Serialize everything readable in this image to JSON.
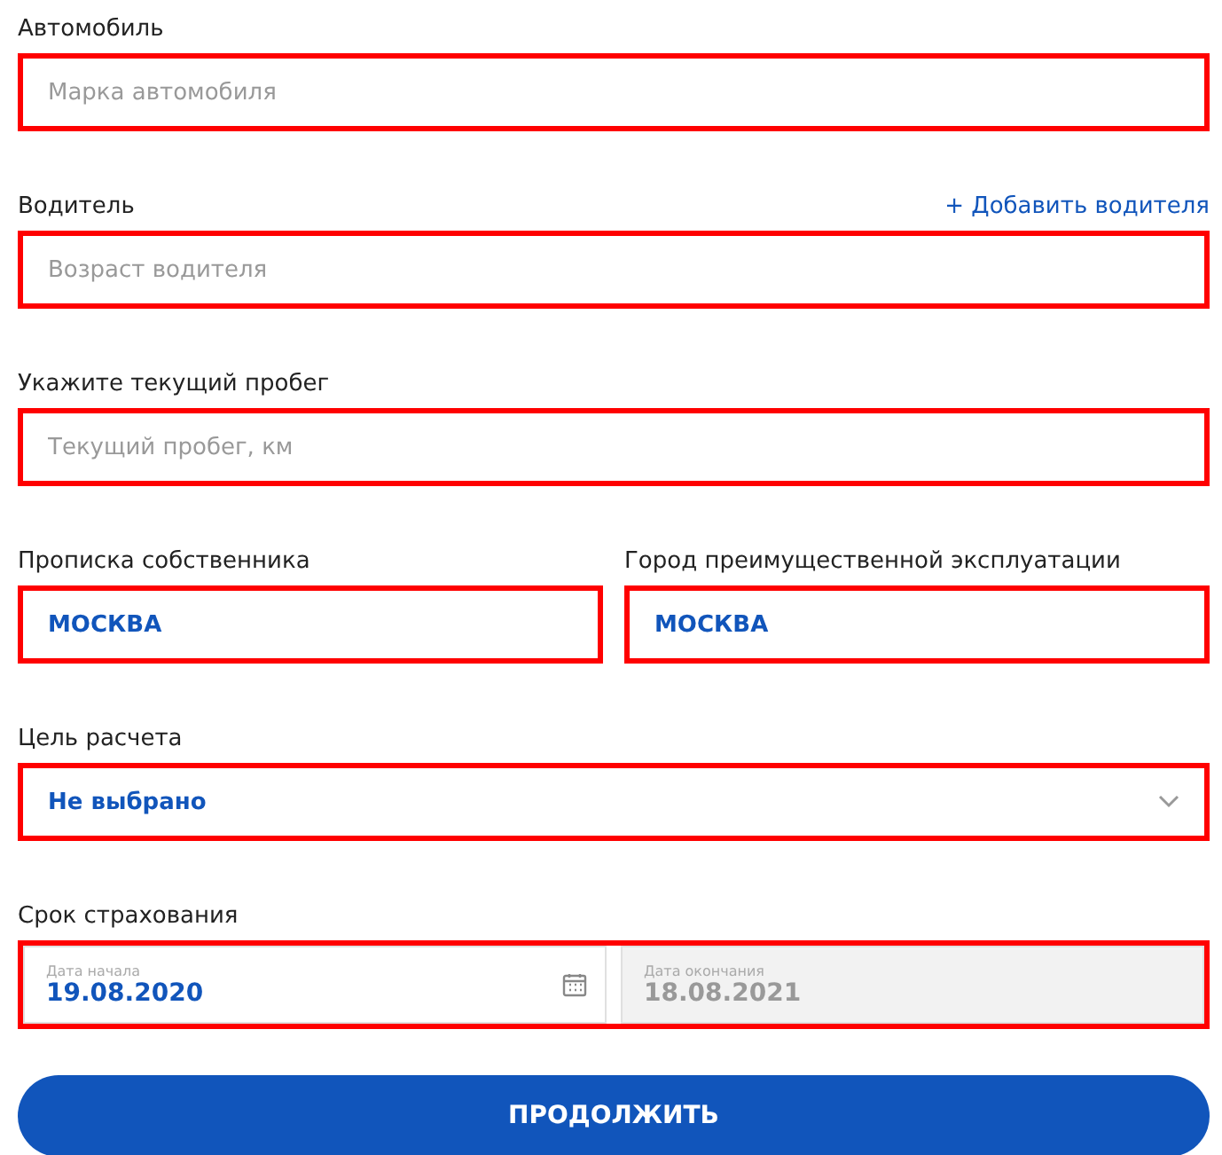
{
  "sections": [
    {
      "kind": "text",
      "label": "Автомобиль",
      "fields": [
        {
          "placeholder": "Марка автомобиля",
          "highlighted": true
        }
      ]
    },
    {
      "kind": "text",
      "label": "Водитель",
      "link": "+ Добавить водителя",
      "fields": [
        {
          "placeholder": "Возраст водителя",
          "highlighted": true
        }
      ]
    },
    {
      "kind": "text",
      "label": "Укажите текущий пробег",
      "fields": [
        {
          "placeholder": "Текущий пробег, км",
          "highlighted": true
        }
      ]
    },
    {
      "kind": "pair",
      "fields": [
        {
          "label": "Прописка собственника",
          "value": "МОСКВА",
          "highlighted": true
        },
        {
          "label": "Город преимущественной эксплуатации",
          "value": "МОСКВА",
          "highlighted": true
        }
      ]
    },
    {
      "kind": "select",
      "label": "Цель расчета",
      "fields": [
        {
          "value": "Не выбрано",
          "highlighted": true
        }
      ]
    },
    {
      "kind": "dates",
      "label": "Срок страхования",
      "highlighted": true,
      "fields": [
        {
          "caption": "Дата начала",
          "value": "19.08.2020",
          "disabled": false
        },
        {
          "caption": "Дата окончания",
          "value": "18.08.2021",
          "disabled": true
        }
      ]
    }
  ],
  "submit": "ПРОДОЛЖИТЬ"
}
